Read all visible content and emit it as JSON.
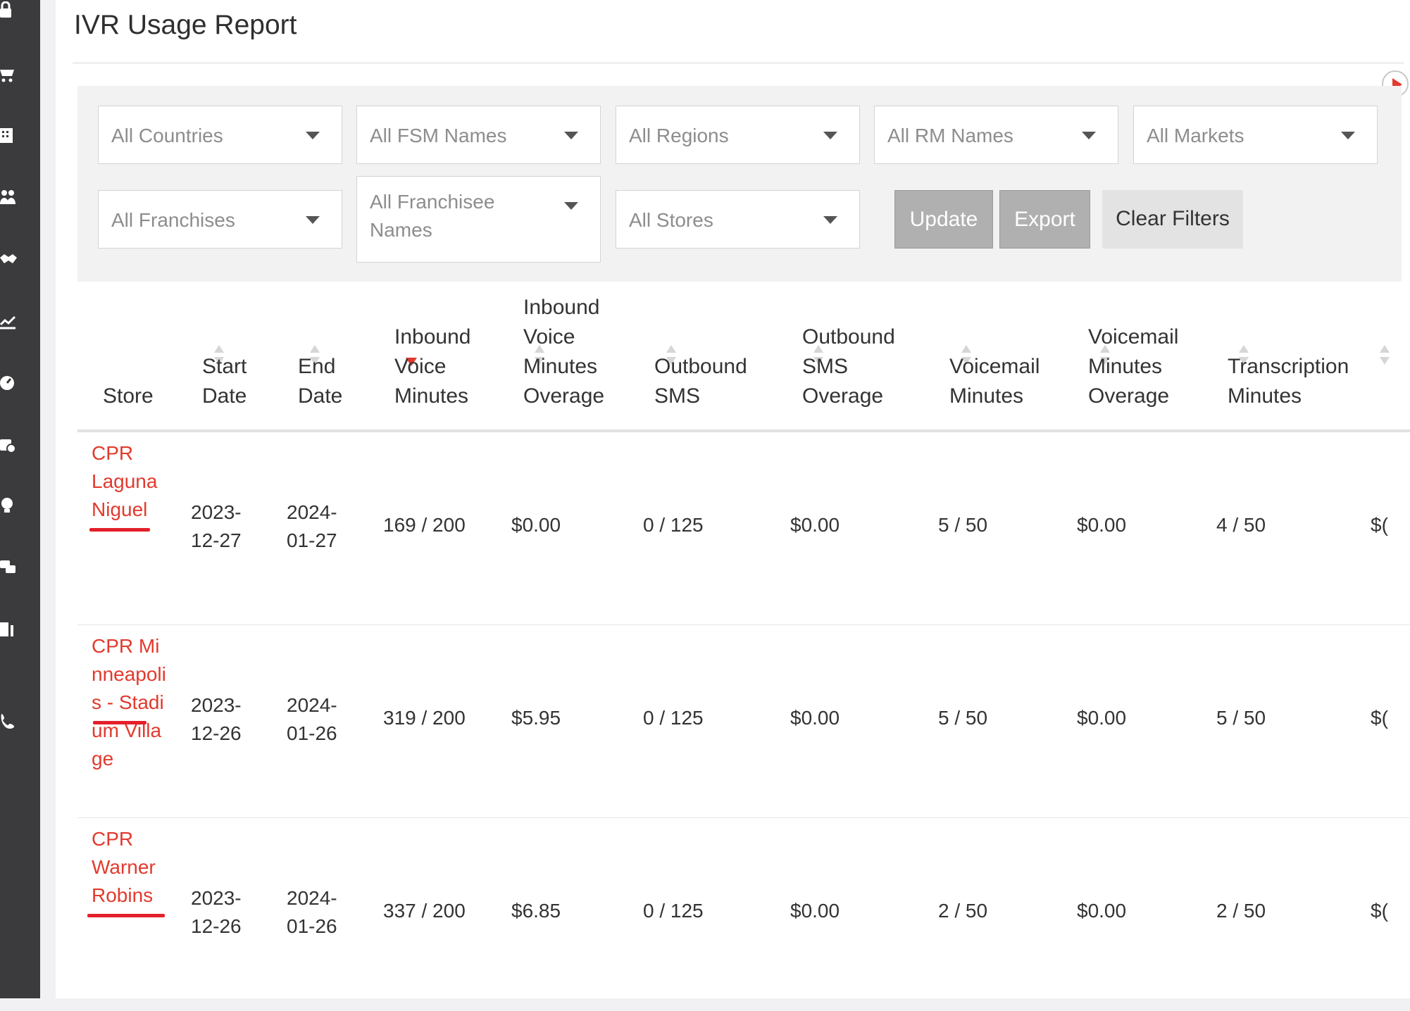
{
  "page": {
    "title": "IVR Usage Report"
  },
  "sidebar": {
    "icons": [
      "lock-icon",
      "cart-icon",
      "building-icon",
      "users-icon",
      "handshake-icon",
      "chart-icon",
      "gauge-icon",
      "calendar-clock-icon",
      "lightbulb-icon",
      "chat-icon",
      "door-icon",
      "phone-icon"
    ]
  },
  "filters": {
    "countries": "All Countries",
    "fsm_names": "All FSM Names",
    "regions": "All Regions",
    "rm_names": "All RM Names",
    "markets": "All Markets",
    "franchises": "All Franchises",
    "franchisee_names": "All Franchisee Names",
    "stores": "All Stores"
  },
  "buttons": {
    "update": "Update",
    "export": "Export",
    "clear": "Clear Filters"
  },
  "table": {
    "headers": {
      "store": "Store",
      "start_date": "Start Date",
      "end_date": "End Date",
      "inbound_voice": "Inbound Voice Minutes",
      "inbound_overage": "Inbound Voice Minutes Overage",
      "outbound_sms": "Outbound SMS",
      "outbound_sms_overage": "Outbound SMS Overage",
      "voicemail": "Voicemail Minutes",
      "voicemail_overage": "Voicemail Minutes Overage",
      "transcription": "Transcription Minutes"
    },
    "rows": [
      {
        "store": "CPR Laguna Niguel",
        "start_date": "2023-12-27",
        "end_date": "2024-01-27",
        "inbound_voice": "169 / 200",
        "inbound_overage": "$0.00",
        "outbound_sms": "0 / 125",
        "outbound_sms_overage": "$0.00",
        "voicemail": "5 / 50",
        "voicemail_overage": "$0.00",
        "transcription": "4 / 50",
        "transcription_overage": "$("
      },
      {
        "store": "CPR Minneapolis - Stadium Village",
        "start_date": "2023-12-26",
        "end_date": "2024-01-26",
        "inbound_voice": "319 / 200",
        "inbound_overage": "$5.95",
        "outbound_sms": "0 / 125",
        "outbound_sms_overage": "$0.00",
        "voicemail": "5 / 50",
        "voicemail_overage": "$0.00",
        "transcription": "5 / 50",
        "transcription_overage": "$("
      },
      {
        "store": "CPR Warner Robins",
        "start_date": "2023-12-26",
        "end_date": "2024-01-26",
        "inbound_voice": "337 / 200",
        "inbound_overage": "$6.85",
        "outbound_sms": "0 / 125",
        "outbound_sms_overage": "$0.00",
        "voicemail": "2 / 50",
        "voicemail_overage": "$0.00",
        "transcription": "2 / 50",
        "transcription_overage": "$("
      }
    ]
  },
  "colors": {
    "accent": "#e23a2e",
    "sidebar": "#3b3b3e",
    "panel": "#f2f2f2",
    "button_disabled": "#b0b0b0"
  }
}
